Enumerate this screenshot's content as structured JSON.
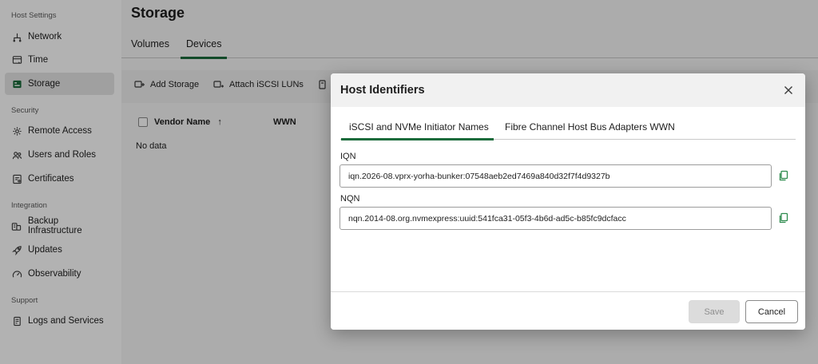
{
  "sidebar": {
    "sections": [
      {
        "label": "Host Settings"
      },
      {
        "label": "Security"
      },
      {
        "label": "Integration"
      },
      {
        "label": "Support"
      }
    ],
    "items": [
      {
        "label": "Network",
        "icon": "network-icon"
      },
      {
        "label": "Time",
        "icon": "clock-icon"
      },
      {
        "label": "Storage",
        "icon": "storage-icon",
        "active": true
      },
      {
        "label": "Remote Access",
        "icon": "gear-icon"
      },
      {
        "label": "Users and Roles",
        "icon": "users-icon"
      },
      {
        "label": "Certificates",
        "icon": "certificate-icon"
      },
      {
        "label": "Backup Infrastructure",
        "icon": "server-icon"
      },
      {
        "label": "Updates",
        "icon": "rocket-icon"
      },
      {
        "label": "Observability",
        "icon": "gauge-icon"
      },
      {
        "label": "Logs and Services",
        "icon": "document-icon"
      }
    ]
  },
  "main": {
    "title": "Storage",
    "tabs": [
      {
        "label": "Volumes"
      },
      {
        "label": "Devices",
        "active": true
      }
    ],
    "toolbar": [
      {
        "label": "Add Storage",
        "icon": "add-storage-icon"
      },
      {
        "label": "Attach iSCSI LUNs",
        "icon": "attach-icon"
      },
      {
        "label": "",
        "icon": "device-icon"
      }
    ],
    "table": {
      "columns": [
        "Vendor Name",
        "WWN"
      ],
      "sort_indicator": "↑",
      "empty_text": "No data"
    }
  },
  "dialog": {
    "title": "Host Identifiers",
    "tabs": [
      {
        "label": "iSCSI and NVMe Initiator Names",
        "active": true
      },
      {
        "label": "Fibre Channel Host Bus Adapters WWN"
      }
    ],
    "fields": [
      {
        "label": "IQN",
        "value": "iqn.2026-08.vprx-yorha-bunker:07548aeb2ed7469a840d32f7f4d9327b"
      },
      {
        "label": "NQN",
        "value": "nqn.2014-08.org.nvmexpress:uuid:541fca31-05f3-4b6d-ad5c-b85fc9dcfacc"
      }
    ],
    "buttons": {
      "save": "Save",
      "cancel": "Cancel"
    }
  },
  "colors": {
    "accent": "#1b6b3b",
    "copy_icon": "#2e8b4e"
  }
}
